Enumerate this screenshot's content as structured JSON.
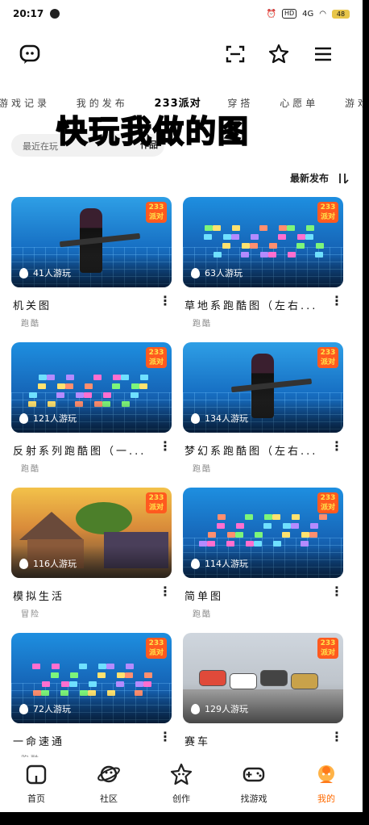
{
  "status": {
    "time": "20:17",
    "network": "4G",
    "battery": "48"
  },
  "topbar": {
    "icons": [
      "chat-bubble-icon",
      "scan-icon",
      "star-add-icon",
      "menu-icon"
    ]
  },
  "tabs": [
    {
      "label": "游戏记录",
      "active": false
    },
    {
      "label": "我的发布",
      "active": false
    },
    {
      "label": "233派对",
      "active": true
    },
    {
      "label": "穿搭",
      "active": false
    },
    {
      "label": "心愿单",
      "active": false
    },
    {
      "label": "游戏",
      "active": false
    }
  ],
  "overlay_title": "快玩我做的图",
  "search": {
    "placeholder": "最近在玩",
    "chip": "作品"
  },
  "sort": {
    "label": "最新发布",
    "icon": "sort-icon"
  },
  "badge_text": "233派对",
  "cards": [
    {
      "title": "机关图",
      "plays": "41人游玩",
      "tag": "跑酷",
      "scene": "character"
    },
    {
      "title": "草地系跑酷图（左右...",
      "plays": "63人游玩",
      "tag": "跑酷",
      "scene": "blocks"
    },
    {
      "title": "反射系列跑酷图（一...",
      "plays": "121人游玩",
      "tag": "跑酷",
      "scene": "blocks"
    },
    {
      "title": "梦幻系跑酷图（左右...",
      "plays": "134人游玩",
      "tag": "跑酷",
      "scene": "character"
    },
    {
      "title": "模拟生活",
      "plays": "116人游玩",
      "tag": "冒险",
      "scene": "village"
    },
    {
      "title": "简单图",
      "plays": "114人游玩",
      "tag": "跑酷",
      "scene": "blocks"
    },
    {
      "title": "一命速通",
      "plays": "72人游玩",
      "tag": "跑酷",
      "scene": "blocks"
    },
    {
      "title": "赛车",
      "plays": "129人游玩",
      "tag": "",
      "scene": "cars"
    }
  ],
  "nav": [
    {
      "label": "首页",
      "icon": "home-icon",
      "active": false
    },
    {
      "label": "社区",
      "icon": "planet-icon",
      "active": false
    },
    {
      "label": "创作",
      "icon": "create-star-icon",
      "active": false
    },
    {
      "label": "找游戏",
      "icon": "gamepad-icon",
      "active": false
    },
    {
      "label": "我的",
      "icon": "avatar-icon",
      "active": true
    }
  ],
  "colors": {
    "accent": "#ff6a00",
    "badge": "#ff5a1f",
    "overlay_text": "#f4f7a0"
  }
}
